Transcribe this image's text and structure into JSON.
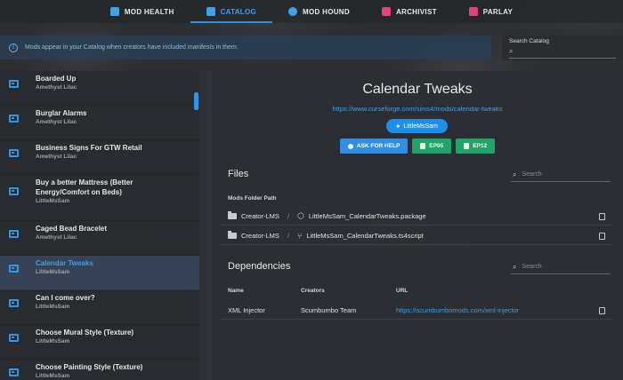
{
  "nav": {
    "tabs": [
      {
        "label": "MOD HEALTH",
        "icon": "medkit-icon",
        "color": "#3ea0e8"
      },
      {
        "label": "CATALOG",
        "icon": "book-icon",
        "color": "#3ea0e8"
      },
      {
        "label": "MOD HOUND",
        "icon": "dog-icon",
        "color": "#3ea0e8"
      },
      {
        "label": "ARCHIVIST",
        "icon": "archive-icon",
        "color": "#e0457a"
      },
      {
        "label": "PARLAY",
        "icon": "translate-icon",
        "color": "#e0457a"
      }
    ],
    "active": "CATALOG"
  },
  "banner": {
    "text": "Mods appear in your Catalog when creators have included manifests in them."
  },
  "catalog_search": {
    "label": "Search Catalog",
    "value": ""
  },
  "sidebar": {
    "items": [
      {
        "title": "Boarded Up",
        "creator": "Amethyst Lilac"
      },
      {
        "title": "Burglar Alarms",
        "creator": "Amethyst Lilac"
      },
      {
        "title": "Business Signs For GTW Retail",
        "creator": "Amethyst Lilac"
      },
      {
        "title": "Buy a better Mattress (Better Energy/Comfort on Beds)",
        "creator": "LittleMsSam"
      },
      {
        "title": "Caged Bead Bracelet",
        "creator": "Amethyst Lilac"
      },
      {
        "title": "Calendar Tweaks",
        "creator": "LittleMsSam",
        "active": true
      },
      {
        "title": "Can I come over?",
        "creator": "LittleMsSam"
      },
      {
        "title": "Choose Mural Style (Texture)",
        "creator": "LittleMsSam"
      },
      {
        "title": "Choose Painting Style (Texture)",
        "creator": "LittleMsSam"
      }
    ]
  },
  "mod": {
    "title": "Calendar Tweaks",
    "url": "https://www.curseforge.com/sims4/mods/calendar-tweaks",
    "creator": "LittleMsSam",
    "help_label": "ASK FOR HELP",
    "packs": [
      "EP05",
      "EP12"
    ]
  },
  "files": {
    "title": "Files",
    "search_placeholder": "Search",
    "column": "Mods Folder Path",
    "rows": [
      {
        "folder": "Creator-LMS",
        "file": "LittleMsSam_CalendarTweaks.package",
        "icon": "package-icon"
      },
      {
        "folder": "Creator-LMS",
        "file": "LittleMsSam_CalendarTweaks.ts4script",
        "icon": "script-branch-icon"
      }
    ]
  },
  "dependencies": {
    "title": "Dependencies",
    "search_placeholder": "Search",
    "columns": [
      "Name",
      "Creators",
      "URL"
    ],
    "rows": [
      {
        "name": "XML Injector",
        "creators": "Scumbumbo Team",
        "url": "https://scumbumbomods.com/xml-injector"
      }
    ]
  }
}
